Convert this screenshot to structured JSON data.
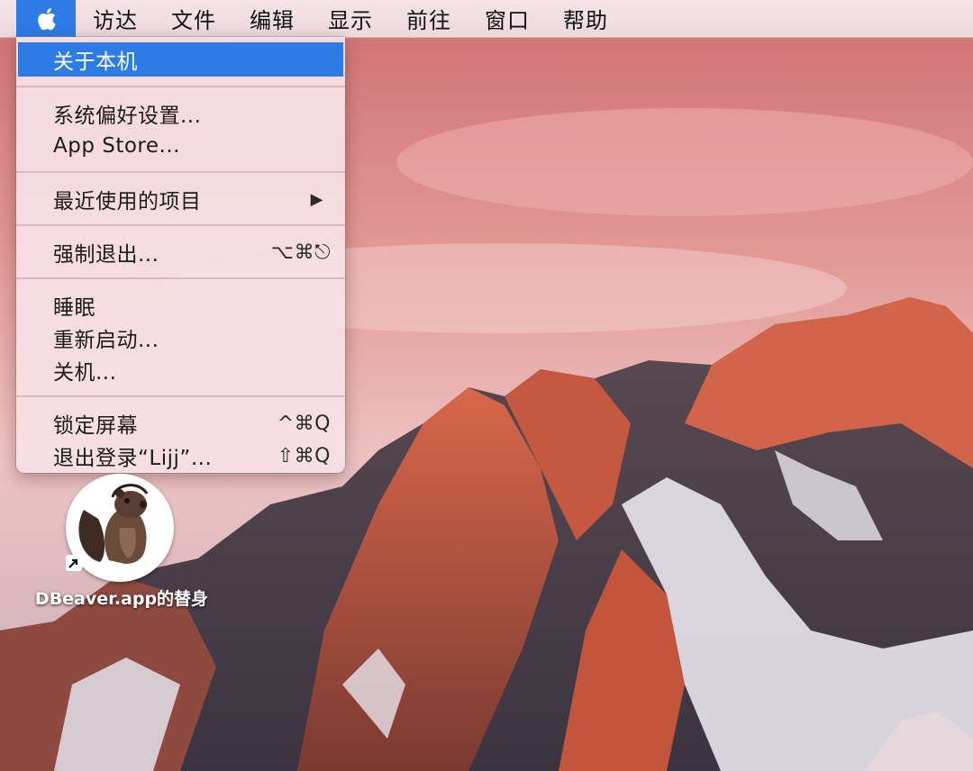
{
  "menubar": {
    "apple_icon": "apple-logo-icon",
    "items": [
      "访达",
      "文件",
      "编辑",
      "显示",
      "前往",
      "窗口",
      "帮助"
    ]
  },
  "apple_menu": {
    "about": "关于本机",
    "system_prefs": "系统偏好设置...",
    "app_store": "App Store...",
    "recent_items": "最近使用的项目",
    "submenu_arrow": "▶",
    "force_quit": "强制退出...",
    "force_quit_shortcut": "⌥⌘⎋",
    "sleep": "睡眠",
    "restart": "重新启动...",
    "shutdown": "关机...",
    "lock_screen": "锁定屏幕",
    "lock_screen_shortcut": "^⌘Q",
    "logout": "退出登录“Lijj”...",
    "logout_shortcut": "⇧⌘Q"
  },
  "desktop": {
    "wallpaper": "sierra-mountain-sunset",
    "icon_label": "DBeaver.app的替身",
    "icon_name": "dbeaver-beaver-icon"
  },
  "colors": {
    "selection": "#2d7ce6",
    "menubar": "#f1dfe3",
    "sky_top": "#d9787a",
    "rock": "#c2553c"
  }
}
